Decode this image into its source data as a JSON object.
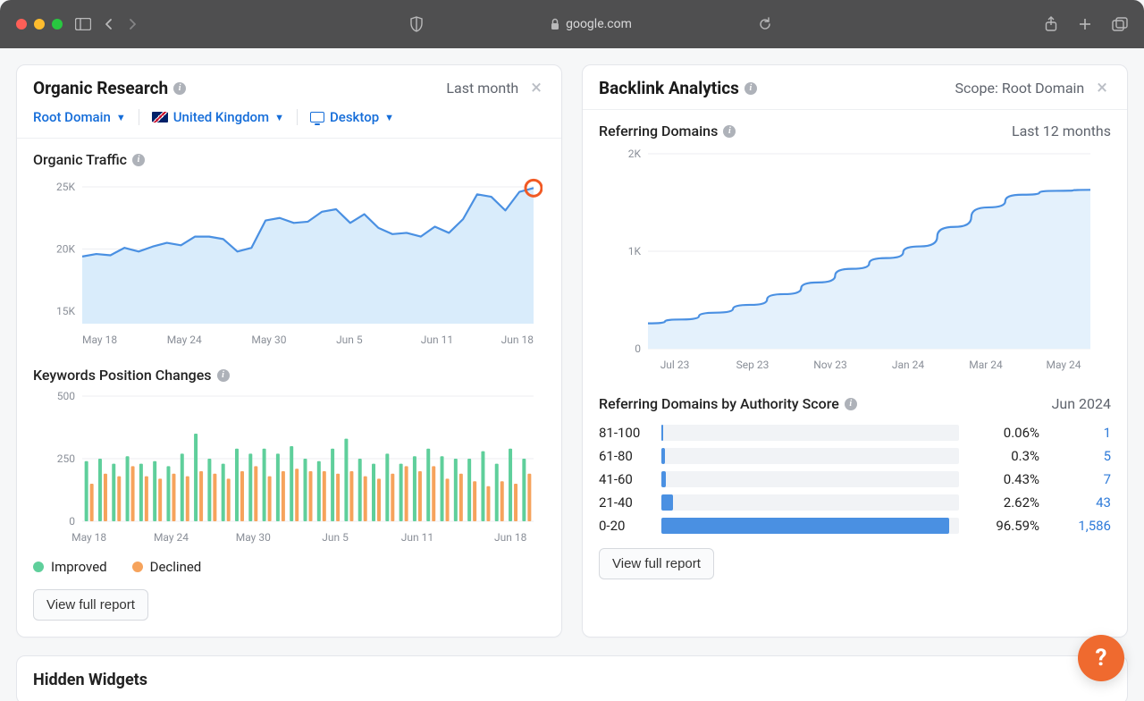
{
  "browser": {
    "url_host": "google.com"
  },
  "left_panel": {
    "title": "Organic Research",
    "meta": "Last month",
    "filters": {
      "scope": "Root Domain",
      "country": "United Kingdom",
      "device": "Desktop"
    },
    "traffic_section_title": "Organic Traffic",
    "keywords_section_title": "Keywords Position Changes",
    "legend_improved": "Improved",
    "legend_declined": "Declined",
    "view_full_report": "View full report"
  },
  "right_panel": {
    "title": "Backlink Analytics",
    "meta": "Scope: Root Domain",
    "ref_domains_title": "Referring Domains",
    "ref_domains_range": "Last 12 months",
    "auth_title": "Referring Domains by Authority Score",
    "auth_date": "Jun 2024",
    "view_full_report": "View full report",
    "auth_rows": [
      {
        "label": "81-100",
        "pct": "0.06%",
        "count": "1",
        "fill": 0.6
      },
      {
        "label": "61-80",
        "pct": "0.3%",
        "count": "5",
        "fill": 1.2
      },
      {
        "label": "41-60",
        "pct": "0.43%",
        "count": "7",
        "fill": 1.5
      },
      {
        "label": "21-40",
        "pct": "2.62%",
        "count": "43",
        "fill": 4
      },
      {
        "label": "0-20",
        "pct": "96.59%",
        "count": "1,586",
        "fill": 96.59
      }
    ]
  },
  "hidden_widgets_title": "Hidden Widgets",
  "chart_data": [
    {
      "type": "area",
      "title": "Organic Traffic",
      "ylabel": "",
      "y_ticks": [
        15000,
        20000,
        25000
      ],
      "x_ticks": [
        "May 18",
        "May 24",
        "May 30",
        "Jun 5",
        "Jun 11",
        "Jun 18"
      ],
      "series": [
        {
          "name": "Organic Traffic",
          "color": "#4a90e2",
          "values": [
            19400,
            19600,
            19500,
            20100,
            19800,
            20200,
            20500,
            20300,
            21000,
            21000,
            20800,
            19800,
            20100,
            22300,
            22500,
            22100,
            22200,
            23000,
            23200,
            22100,
            22800,
            21700,
            21200,
            21300,
            21000,
            21800,
            21300,
            22400,
            24400,
            24200,
            23100,
            24600,
            24900
          ]
        }
      ],
      "highlight_index": 32
    },
    {
      "type": "bar",
      "title": "Keywords Position Changes",
      "y_ticks": [
        0,
        250,
        500
      ],
      "x_ticks": [
        "May 18",
        "May 24",
        "May 30",
        "Jun 5",
        "Jun 11",
        "Jun 18"
      ],
      "series": [
        {
          "name": "Improved",
          "color": "#5fcf9b",
          "values": [
            240,
            250,
            230,
            260,
            230,
            240,
            220,
            270,
            350,
            250,
            230,
            290,
            270,
            290,
            270,
            300,
            250,
            240,
            290,
            330,
            250,
            230,
            270,
            230,
            260,
            290,
            260,
            250,
            250,
            280,
            230,
            290,
            250
          ]
        },
        {
          "name": "Declined",
          "color": "#f6a35c",
          "values": [
            150,
            190,
            180,
            220,
            180,
            170,
            190,
            180,
            200,
            190,
            170,
            200,
            220,
            180,
            200,
            210,
            200,
            200,
            190,
            200,
            180,
            170,
            190,
            220,
            200,
            220,
            170,
            190,
            160,
            140,
            160,
            150,
            190
          ]
        }
      ]
    },
    {
      "type": "area",
      "title": "Referring Domains",
      "y_ticks": [
        0,
        1000,
        2000
      ],
      "y_tick_labels": [
        "0",
        "1K",
        "2K"
      ],
      "x_ticks": [
        "Jul 23",
        "Sep 23",
        "Nov 23",
        "Jan 24",
        "Mar 24",
        "May 24"
      ],
      "series": [
        {
          "name": "Referring Domains",
          "color": "#4a90e2",
          "values": [
            260,
            300,
            370,
            450,
            560,
            680,
            820,
            930,
            1050,
            1250,
            1450,
            1580,
            1620,
            1630
          ]
        }
      ]
    },
    {
      "type": "bar",
      "title": "Referring Domains by Authority Score",
      "categories": [
        "81-100",
        "61-80",
        "41-60",
        "21-40",
        "0-20"
      ],
      "series": [
        {
          "name": "percent",
          "values": [
            0.06,
            0.3,
            0.43,
            2.62,
            96.59
          ]
        },
        {
          "name": "count",
          "values": [
            1,
            5,
            7,
            43,
            1586
          ]
        }
      ]
    }
  ]
}
